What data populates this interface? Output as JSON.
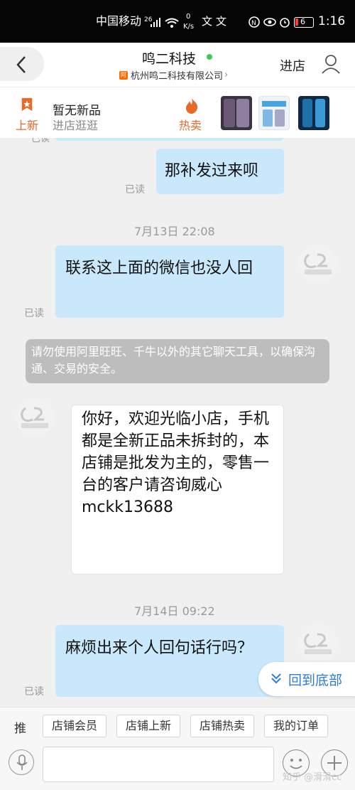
{
  "status_bar": {
    "carrier": "中国移动",
    "network": "26",
    "speed_value": "0",
    "speed_unit": "K/s",
    "battery": "6",
    "time": "1:16"
  },
  "header": {
    "shop_name": "鸣二科技",
    "company": "杭州鸣二科技有限公司",
    "enter_shop": "进店"
  },
  "promo": {
    "new_label": "上新",
    "no_new_title": "暂无新品",
    "no_new_sub": "进店逛逛",
    "hot_label": "热卖"
  },
  "messages": {
    "partial_read": "已读",
    "msg1": "那补发过来呗",
    "msg1_read": "已读",
    "time1": "7月13日 22:08",
    "msg2": "联系这上面的微信也没人回",
    "msg2_read": "已读",
    "system_notice": "请勿使用阿里旺旺、千牛以外的其它聊天工具，以确保沟通、交易的安全。",
    "reply": "你好，欢迎光临小店，手机都是全新正品未拆封的，本店铺是批发为主的，零售一台的客户请咨询威心  mckk13688",
    "time2": "7月14日 09:22",
    "msg3": "麻烦出来个人回句话行吗？",
    "msg3_read": "已读"
  },
  "back_to_bottom": "回到底部",
  "quick_bar": {
    "prefix": "推",
    "buttons": [
      "店铺会员",
      "店铺上新",
      "店铺热卖",
      "我的订单"
    ]
  },
  "input": {
    "placeholder": ""
  },
  "watermark": "知乎 @滑滑cc"
}
